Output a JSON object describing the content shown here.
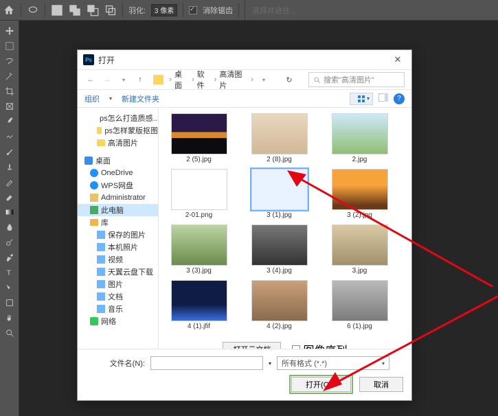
{
  "ps_top": {
    "home": "⌂",
    "feather_label": "羽化:",
    "feather_value": "3 像素",
    "anti_alias": "消除锯齿",
    "select_and_mask": "选择并遮住..."
  },
  "dialog": {
    "title": "打开",
    "breadcrumb": {
      "seg1": "桌面",
      "seg2": "软件",
      "seg3": "高清图片"
    },
    "search_placeholder": "搜索\"高清图片\"",
    "organize": "组织",
    "new_folder": "新建文件夹",
    "tree": {
      "i0": "ps怎么打造质感...",
      "i1": "ps怎样蒙版抠图",
      "i2": "高清图片",
      "desktop": "桌面",
      "onedrive": "OneDrive",
      "wps": "WPS网盘",
      "admin": "Administrator",
      "thispc": "此电脑",
      "lib": "库",
      "saved": "保存的图片",
      "local": "本机照片",
      "video": "视频",
      "tianyi": "天翼云盘下载",
      "pics": "图片",
      "docs": "文档",
      "music": "音乐",
      "network": "网络"
    },
    "files": {
      "f0": "2 (5).jpg",
      "f1": "2 (8).jpg",
      "f2": "2.jpg",
      "f3": "2-01.png",
      "f4": "3 (1).jpg",
      "f5": "3 (2).jpg",
      "f6": "3 (3).jpg",
      "f7": "3 (4).jpg",
      "f8": "3.jpg",
      "f9": "4 (1).jfif",
      "f10": "4 (2).jpg",
      "f11": "6 (1).jpg"
    },
    "cloud_btn": "打开云文档",
    "image_sequence": "图像序列",
    "filename_label": "文件名(N):",
    "filename_value": "",
    "filter_label": "所有格式 (*.*)",
    "open_btn": "打开(O)",
    "cancel_btn": "取消"
  }
}
